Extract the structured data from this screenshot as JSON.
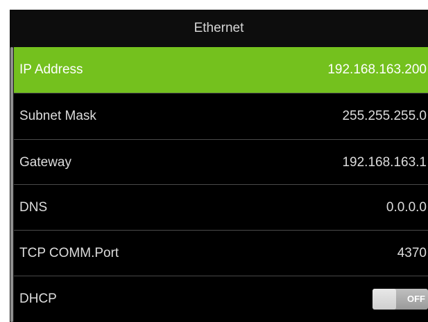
{
  "screen": {
    "title": "Ethernet"
  },
  "settings": [
    {
      "label": "IP Address",
      "value": "192.168.163.200"
    },
    {
      "label": "Subnet Mask",
      "value": "255.255.255.0"
    },
    {
      "label": "Gateway",
      "value": "192.168.163.1"
    },
    {
      "label": "DNS",
      "value": "0.0.0.0"
    },
    {
      "label": "TCP COMM.Port",
      "value": "4370"
    },
    {
      "label": "DHCP",
      "toggle": "OFF"
    }
  ],
  "colors": {
    "selected_row": "#74c11e",
    "background": "#000000"
  }
}
